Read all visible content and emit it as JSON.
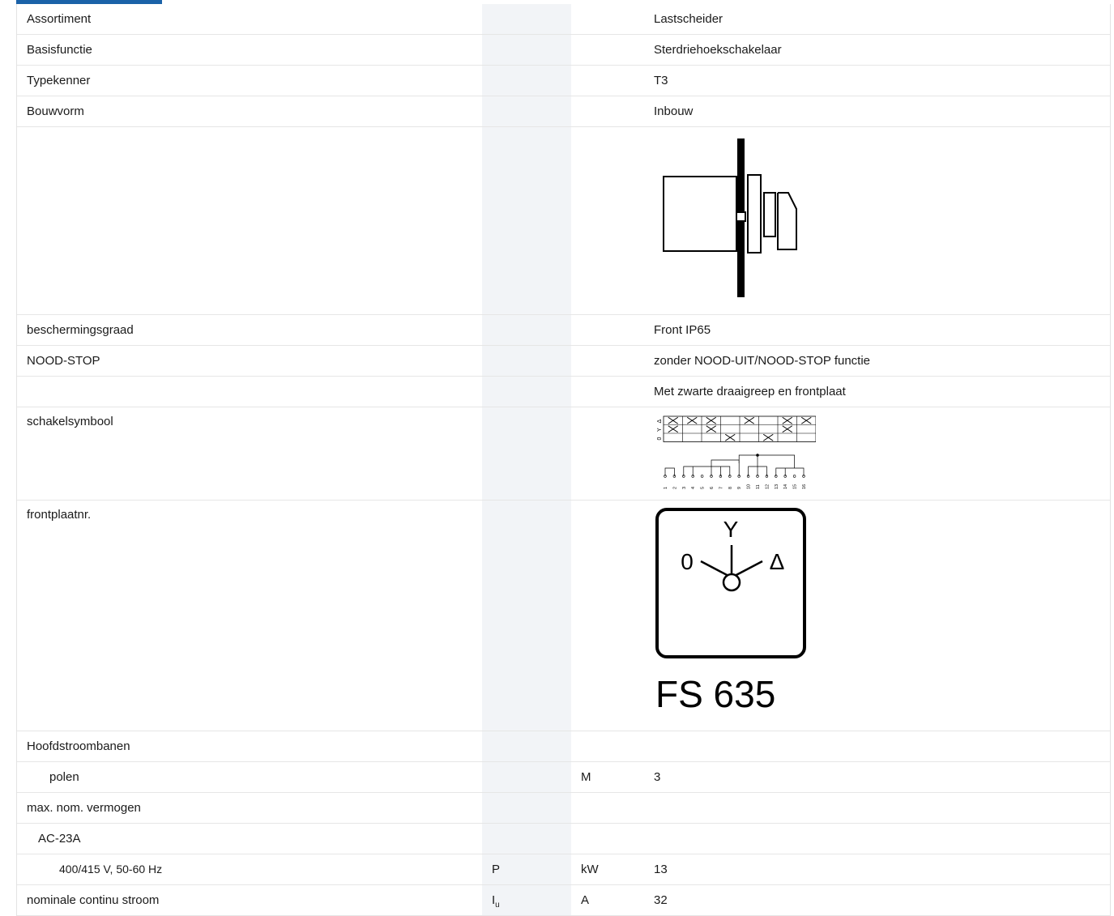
{
  "rows": [
    {
      "label": "Assortiment",
      "value": "Lastscheider"
    },
    {
      "label": "Basisfunctie",
      "value": "Sterdriehoekschakelaar"
    },
    {
      "label": "Typekenner",
      "value": "T3"
    },
    {
      "label": "Bouwvorm",
      "value": "Inbouw"
    },
    {
      "label": "beschermingsgraad",
      "value": "Front IP65"
    },
    {
      "label": "NOOD-STOP",
      "value": "zonder NOOD-UIT/NOOD-STOP functie"
    },
    {
      "label": "",
      "value": "Met zwarte draaigreep en frontplaat"
    },
    {
      "label": "schakelsymbool"
    },
    {
      "label": "frontplaatnr."
    },
    {
      "label": "Hoofdstroombanen",
      "value": ""
    },
    {
      "label": "polen",
      "unit": "M",
      "value": "3"
    },
    {
      "label": "max. nom. vermogen",
      "value": ""
    },
    {
      "label": "AC-23A",
      "value": ""
    },
    {
      "label": "400/415 V, 50-60 Hz",
      "symbol": "P",
      "unit": "kW",
      "value": "13"
    },
    {
      "label": "nominale continu stroom",
      "symbol": "I",
      "symbol_sub": "u",
      "unit": "A",
      "value": "32"
    }
  ],
  "front_plate": {
    "positions": [
      "0",
      "Y",
      "Δ"
    ],
    "code": "FS 635"
  },
  "switch_symbol": {
    "positions": [
      "0",
      "Y",
      "Δ"
    ],
    "terminals": [
      "1",
      "2",
      "3",
      "4",
      "5",
      "6",
      "7",
      "8",
      "9",
      "10",
      "11",
      "12",
      "13",
      "14",
      "15",
      "16"
    ]
  }
}
